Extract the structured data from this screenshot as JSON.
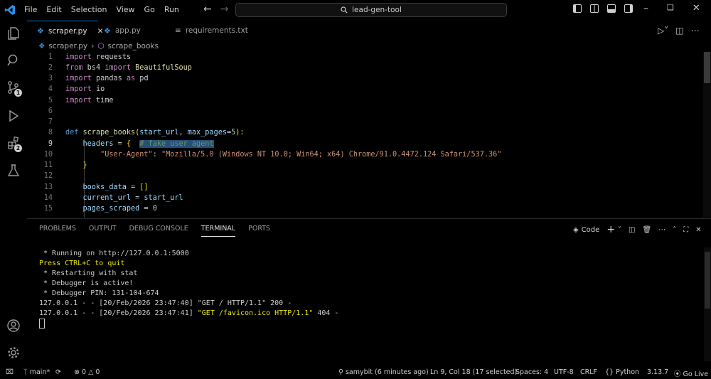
{
  "menu": [
    "File",
    "Edit",
    "Selection",
    "View",
    "Go",
    "Run"
  ],
  "search": {
    "text": "lead-gen-tool"
  },
  "tabs": [
    {
      "label": "scraper.py",
      "active": true
    },
    {
      "label": "app.py",
      "active": false
    },
    {
      "label": "requirements.txt",
      "active": false
    }
  ],
  "breadcrumb": {
    "file": "scraper.py",
    "symbol": "scrape_books"
  },
  "line_numbers": [
    "1",
    "2",
    "3",
    "4",
    "5",
    "6",
    "7",
    "8",
    "9",
    "10",
    "11",
    "12",
    "13",
    "14",
    "15"
  ],
  "code": {
    "l1a": "import",
    "l1b": " requests",
    "l2a": "from",
    "l2b": " bs4 ",
    "l2c": "import",
    "l2d": " BeautifulSoup",
    "l3a": "import",
    "l3b": " pandas ",
    "l3c": "as",
    "l3d": " pd",
    "l4a": "import",
    "l4b": " io",
    "l5a": "import",
    "l5b": " time",
    "l8a": "def",
    "l8b": " scrape_books",
    "l8c": "(",
    "l8d": "start_url",
    "l8e": ", ",
    "l8f": "max_pages",
    "l8g": "=",
    "l8h": "5",
    "l8i": "):",
    "l9a": "    headers",
    "l9b": " = ",
    "l9c": "{",
    "l9d": "  ",
    "l9e": "# fake user agent",
    "l10a": "        ",
    "l10b": "\"User-Agent\"",
    "l10c": ": ",
    "l10d": "\"Mozilla/5.0 (Windows NT 10.0; Win64; x64) Chrome/91.0.4472.124 Safari/537.36\"",
    "l11a": "    ",
    "l11b": "}",
    "l13a": "    books_data",
    "l13b": " = ",
    "l13c": "[]",
    "l14a": "    current_url",
    "l14b": " = ",
    "l14c": "start_url",
    "l15a": "    pages_scraped",
    "l15b": " = ",
    "l15c": "0"
  },
  "panel_tabs": [
    "PROBLEMS",
    "OUTPUT",
    "DEBUG CONSOLE",
    "TERMINAL",
    "PORTS"
  ],
  "panel_right": {
    "shell": "Code"
  },
  "terminal": {
    "t1": " * Running on http://127.0.0.1:5000",
    "t2": "Press CTRL+C to quit",
    "t3": " * Restarting with stat",
    "t4": " * Debugger is active!",
    "t5": " * Debugger PIN: 131-104-674",
    "t6a": "127.0.0.1 - - [20/Feb/2026 23:47:40] ",
    "t6b": "\"GET / HTTP/1.1\"",
    "t6c": " 200 -",
    "t7a": "127.0.0.1 - - [20/Feb/2026 23:47:41] ",
    "t7b": "\"GET /favicon.ico HTTP/1.1\"",
    "t7c": " 404 -"
  },
  "status": {
    "branch": "main*",
    "errors": "0",
    "warnings": "0",
    "blame": "samybit (6 minutes ago)",
    "position": "Ln 9, Col 18 (17 selected)",
    "spaces": "Spaces: 4",
    "encoding": "UTF-8",
    "eol": "CRLF",
    "language": "Python",
    "version": "3.13.7",
    "golive": "Go Live"
  },
  "badges": {
    "source_control": "1",
    "extensions": "2"
  },
  "colors": {
    "accent": "#0078d4",
    "keyword": "#c586c0",
    "function": "#dcdcaa",
    "string": "#ce9178",
    "terminal_yellow": "#e5e510"
  }
}
